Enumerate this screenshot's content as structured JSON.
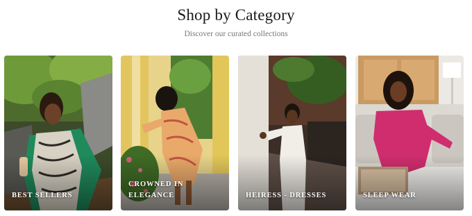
{
  "header": {
    "title": "Shop by Category",
    "subtitle": "Discover our curated collections"
  },
  "categories": [
    {
      "label": "BEST SELLERS"
    },
    {
      "label": "CROWNED IN ELEGANCE"
    },
    {
      "label": "HEIRESS - DRESSES"
    },
    {
      "label": "SLEEP WEAR"
    }
  ]
}
